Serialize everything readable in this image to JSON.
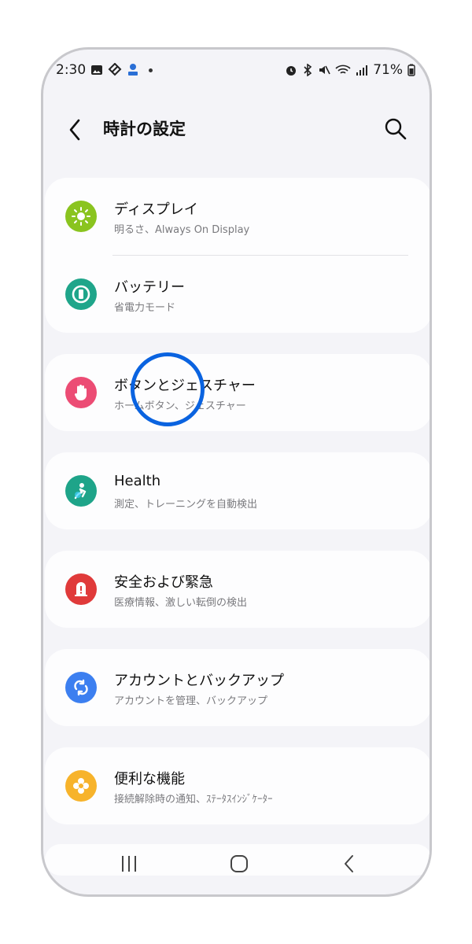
{
  "status_bar": {
    "time": "2:30",
    "battery": "71%",
    "left_icons": [
      "gallery-icon",
      "vpn-icon",
      "app-notification-icon",
      "dot-icon"
    ],
    "right_icons": [
      "alarm-icon",
      "bluetooth-icon",
      "mute-icon",
      "wifi-icon",
      "signal-icon",
      "battery-icon"
    ]
  },
  "header": {
    "title": "時計の設定"
  },
  "sections": [
    {
      "items": [
        {
          "label": "ディスプレイ",
          "sub": "明るさ、Always On Display",
          "icon": "sun-icon",
          "color": "#8ac41f"
        },
        {
          "label": "バッテリー",
          "sub": "省電力モード",
          "icon": "battery-ring-icon",
          "color": "#1fa58a"
        }
      ]
    },
    {
      "items": [
        {
          "label": "ボタンとジェスチャー",
          "sub": "ホームボタン、ジェスチャー",
          "icon": "hand-icon",
          "color": "#ec4c74"
        }
      ]
    },
    {
      "items": [
        {
          "label": "Health",
          "sub": "測定、トレーニングを自動検出",
          "icon": "health-icon",
          "color": "#1ea489"
        }
      ]
    },
    {
      "items": [
        {
          "label": "安全および緊急",
          "sub": "医療情報、激しい転倒の検出",
          "icon": "emergency-icon",
          "color": "#e03a3a"
        }
      ]
    },
    {
      "items": [
        {
          "label": "アカウントとバックアップ",
          "sub": "アカウントを管理、バックアップ",
          "icon": "sync-icon",
          "color": "#3c7ff0"
        }
      ]
    },
    {
      "items": [
        {
          "label": "便利な機能",
          "sub": "接続解除時の通知、ｽﾃｰﾀｽｲﾝｼﾞｹｰﾀｰ",
          "icon": "plus-flower-icon",
          "color": "#f7b32b"
        }
      ]
    }
  ],
  "nav": {
    "recents": "recents-icon",
    "home": "home-icon",
    "back": "back-icon"
  },
  "colors": {
    "touch_indicator": "#0a63e0",
    "background": "#f4f4f8",
    "card": "#fdfdfe"
  }
}
